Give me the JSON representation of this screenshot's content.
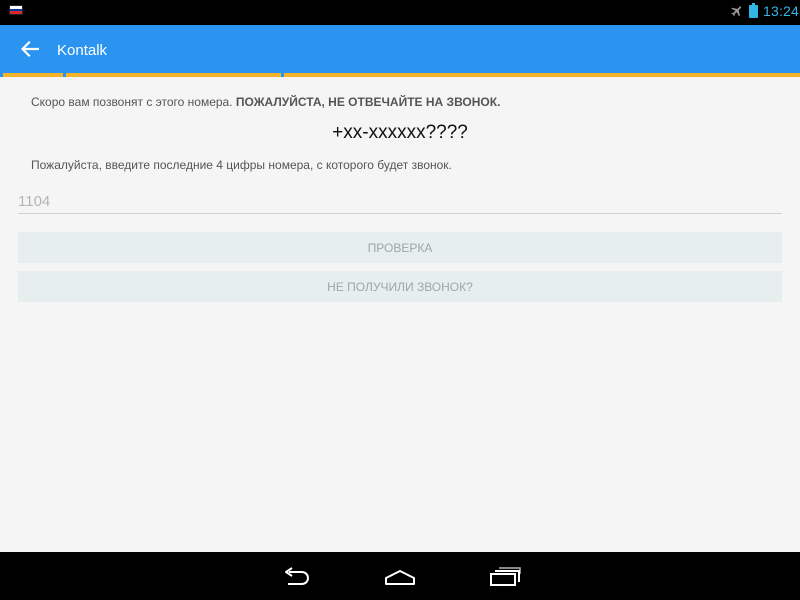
{
  "status_bar": {
    "time": "13:24",
    "icons": [
      "russian-flag-icon",
      "airplane-mode-icon",
      "battery-icon"
    ],
    "clock_color": "#33b5e5"
  },
  "action_bar": {
    "title": "Kontalk",
    "background": "#2b93f0",
    "accent": "#f5b32a"
  },
  "main": {
    "intro_text": "Скоро вам позвонят с этого номера. ",
    "intro_bold": "ПОЖАЛУЙСТА, НЕ ОТВЕЧАЙТЕ НА ЗВОНОК.",
    "phone_number": "+xx-xxxxxx????",
    "hint": "Пожалуйста, введите последние 4 цифры номера, с которого будет звонок.",
    "code_input": {
      "value": "",
      "placeholder": "1104"
    },
    "verify_button": "ПРОВЕРКА",
    "no_call_button": "НЕ ПОЛУЧИЛИ ЗВОНОК?"
  },
  "nav_bar": {
    "buttons": [
      "back-icon",
      "home-icon",
      "recents-icon"
    ]
  }
}
